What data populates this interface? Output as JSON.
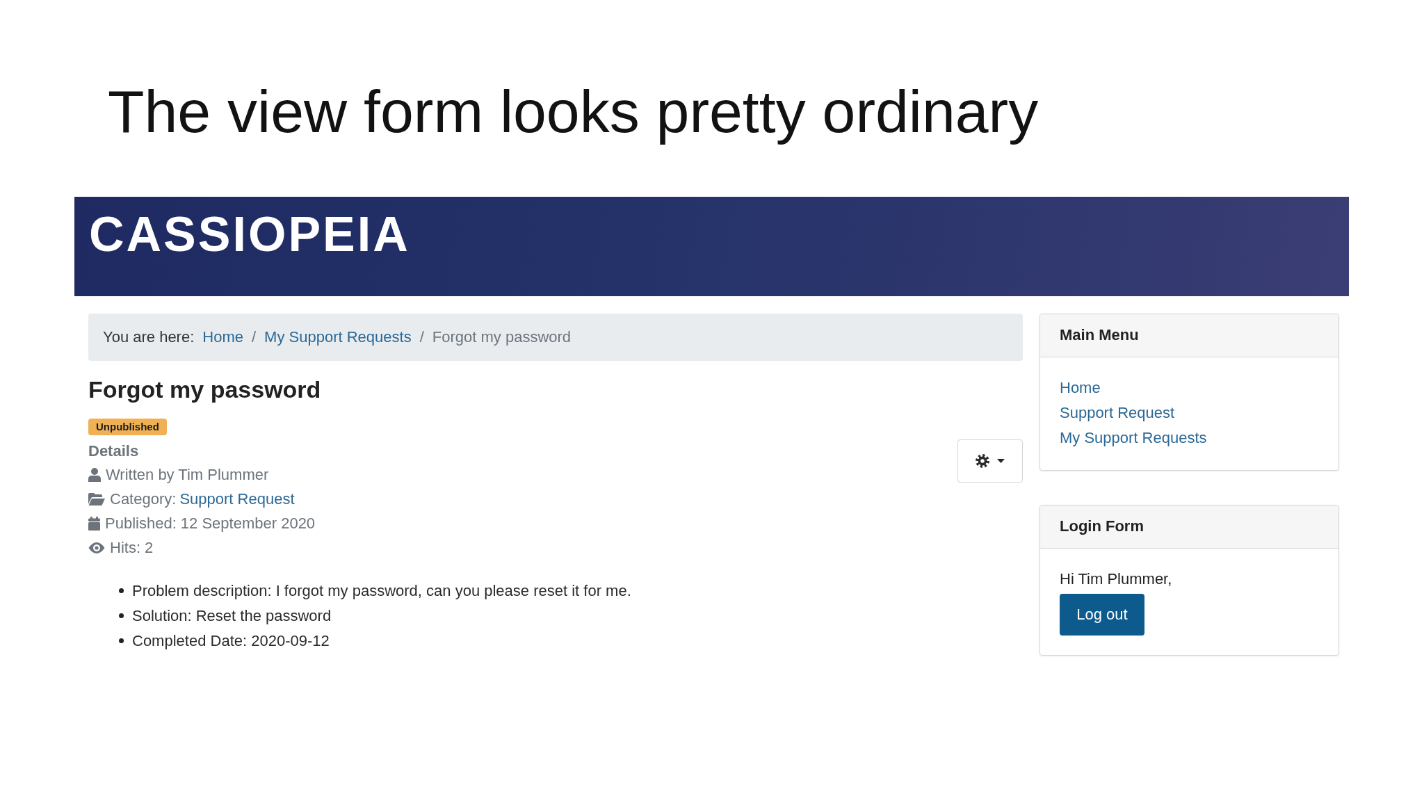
{
  "slide": {
    "title": "The view form looks pretty ordinary"
  },
  "site": {
    "logo": "CASSIOPEIA"
  },
  "breadcrumb": {
    "label": "You are here:",
    "items": [
      {
        "kind": "link",
        "text": "Home"
      },
      {
        "kind": "separator",
        "text": "/"
      },
      {
        "kind": "link",
        "text": "My Support Requests"
      },
      {
        "kind": "separator",
        "text": "/"
      },
      {
        "kind": "current",
        "text": "Forgot my password"
      }
    ]
  },
  "article": {
    "title": "Forgot my password",
    "badge": "Unpublished",
    "details_heading": "Details",
    "meta": [
      {
        "kind": "author",
        "text": "Written by Tim Plummer"
      },
      {
        "kind": "category",
        "text": "Category:",
        "link": "Support Request"
      },
      {
        "kind": "published",
        "text": "Published: 12 September 2020"
      },
      {
        "kind": "hits",
        "text": "Hits: 2"
      }
    ],
    "fields": [
      "Problem description: I forgot my password, can you please reset it for me.",
      "Solution: Reset the password",
      "Completed Date: 2020-09-12"
    ]
  },
  "sidebar": [
    {
      "kind": "menu",
      "title": "Main Menu",
      "links": [
        "Home",
        "Support Request",
        "My Support Requests"
      ]
    },
    {
      "kind": "login",
      "title": "Login Form",
      "greeting": "Hi Tim Plummer,",
      "button": "Log out"
    }
  ]
}
